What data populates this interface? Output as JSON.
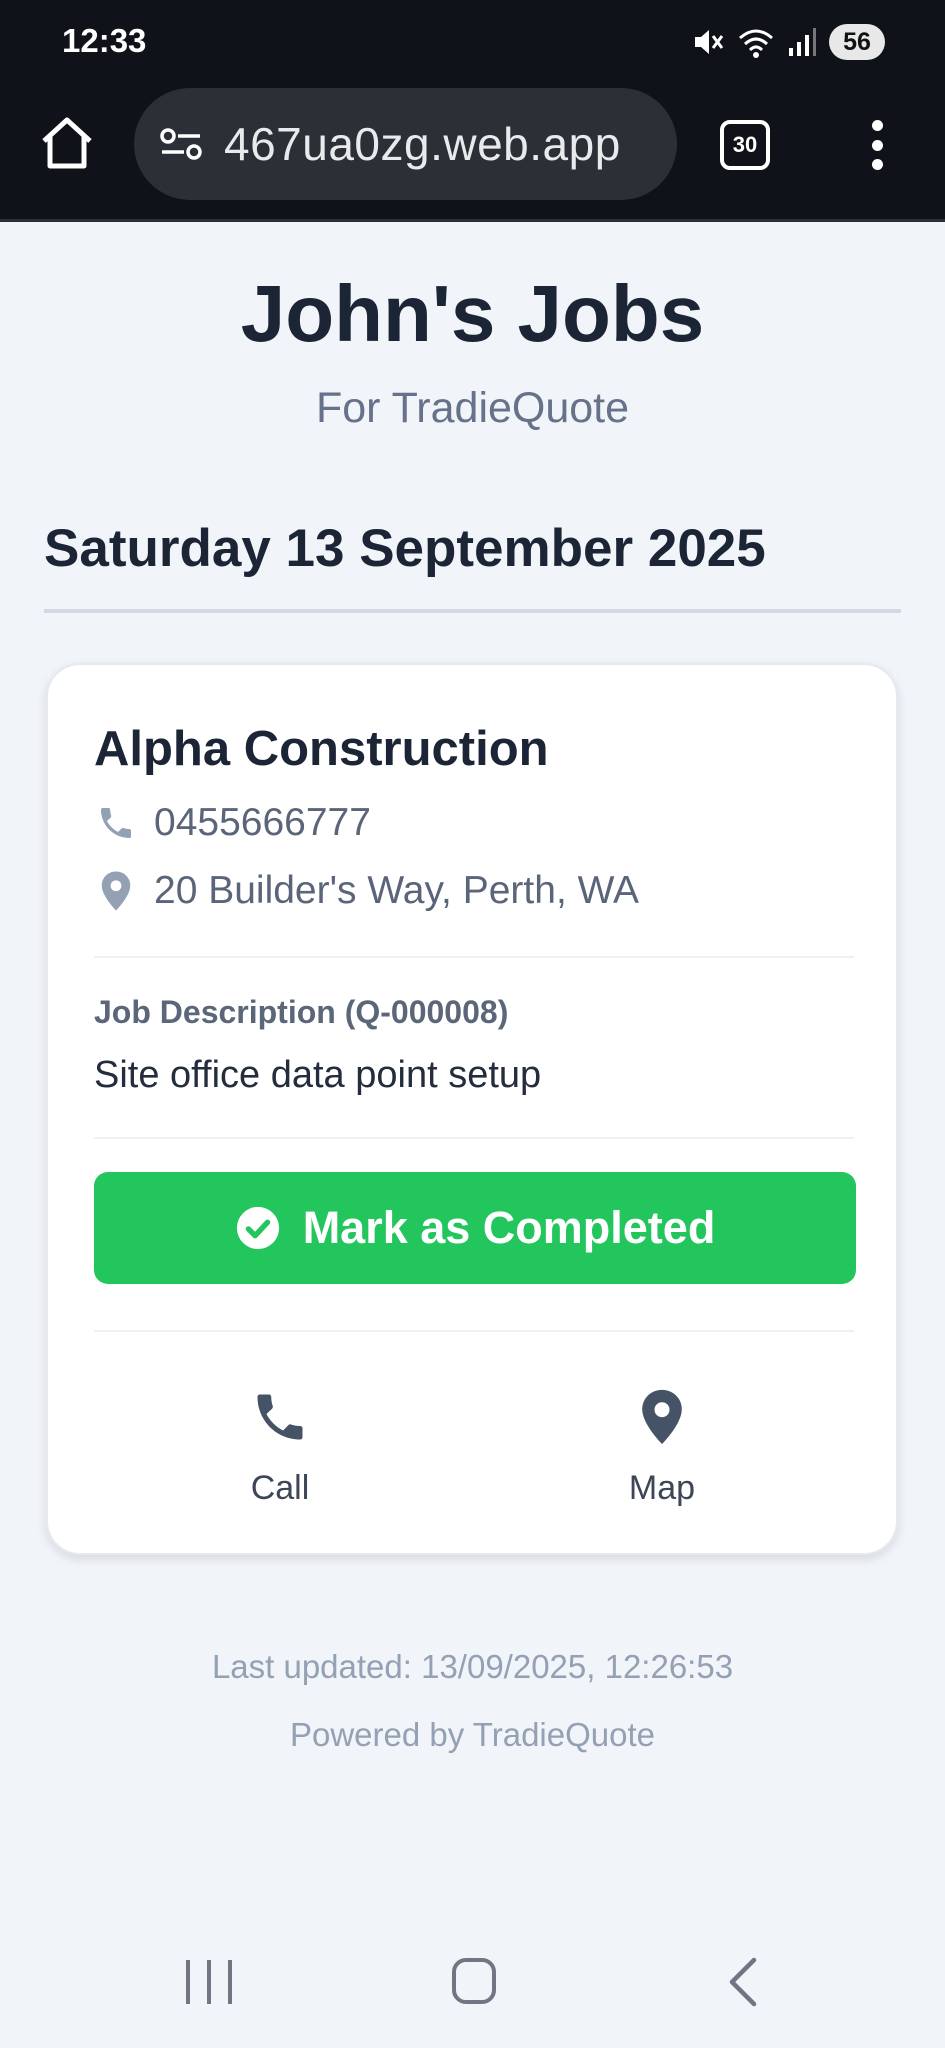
{
  "status_bar": {
    "time": "12:33",
    "battery": "56"
  },
  "browser": {
    "url": "467ua0zg.web.app",
    "tab_count": "30"
  },
  "page": {
    "title": "John's Jobs",
    "subtitle": "For TradieQuote",
    "date": "Saturday 13 September 2025"
  },
  "job": {
    "company": "Alpha Construction",
    "phone": "0455666777",
    "address": "20 Builder's Way, Perth, WA",
    "description_label": "Job Description (Q-000008)",
    "description": "Site office data point setup",
    "complete_button": "Mark as Completed",
    "call_label": "Call",
    "map_label": "Map"
  },
  "footer": {
    "last_updated": "Last updated: 13/09/2025, 12:26:53",
    "powered_by": "Powered by TradieQuote"
  },
  "colors": {
    "accent_green": "#23c55d",
    "heading": "#1c2536",
    "muted": "#94a0b3",
    "background": "#f1f4f8"
  },
  "icons": {
    "phone": "phone-icon",
    "location": "map-pin-icon",
    "check": "check-circle-icon"
  }
}
